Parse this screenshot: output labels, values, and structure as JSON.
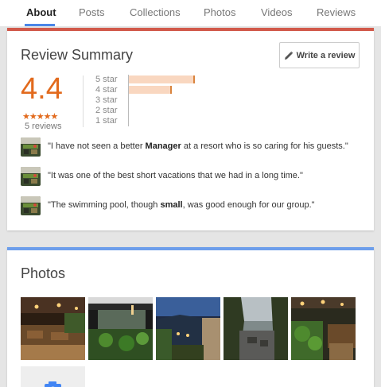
{
  "tabs": [
    {
      "label": "About",
      "active": true
    },
    {
      "label": "Posts"
    },
    {
      "label": "Collections"
    },
    {
      "label": "Photos"
    },
    {
      "label": "Videos"
    },
    {
      "label": "Reviews"
    }
  ],
  "review_summary": {
    "title": "Review Summary",
    "write_review_label": "Write a review",
    "rating": "4.4",
    "stars_text": "★★★★★",
    "review_count": "5 reviews",
    "distribution": [
      {
        "label": "5 star",
        "fraction": 1.0
      },
      {
        "label": "4 star",
        "fraction": 0.65
      },
      {
        "label": "3 star",
        "fraction": 0
      },
      {
        "label": "2 star",
        "fraction": 0
      },
      {
        "label": "1 star",
        "fraction": 0
      }
    ],
    "snippets": [
      {
        "before": "\"I have not seen a better ",
        "bold": "Manager",
        "after": " at a resort who is so caring for his guests.\""
      },
      {
        "before": "\"It was one of the best short vacations that we had in a long time.\"",
        "bold": "",
        "after": ""
      },
      {
        "before": "\"The swimming pool, though ",
        "bold": "small",
        "after": ", was good enough for our group.\""
      }
    ]
  },
  "photos_section": {
    "title": "Photos",
    "photo_count": 5
  },
  "colors": {
    "rating_accent": "#e26a1d",
    "card1_top_border": "#d1594a",
    "card2_top_border": "#6d9eeb",
    "bar_fill": "#f9d7c0"
  }
}
